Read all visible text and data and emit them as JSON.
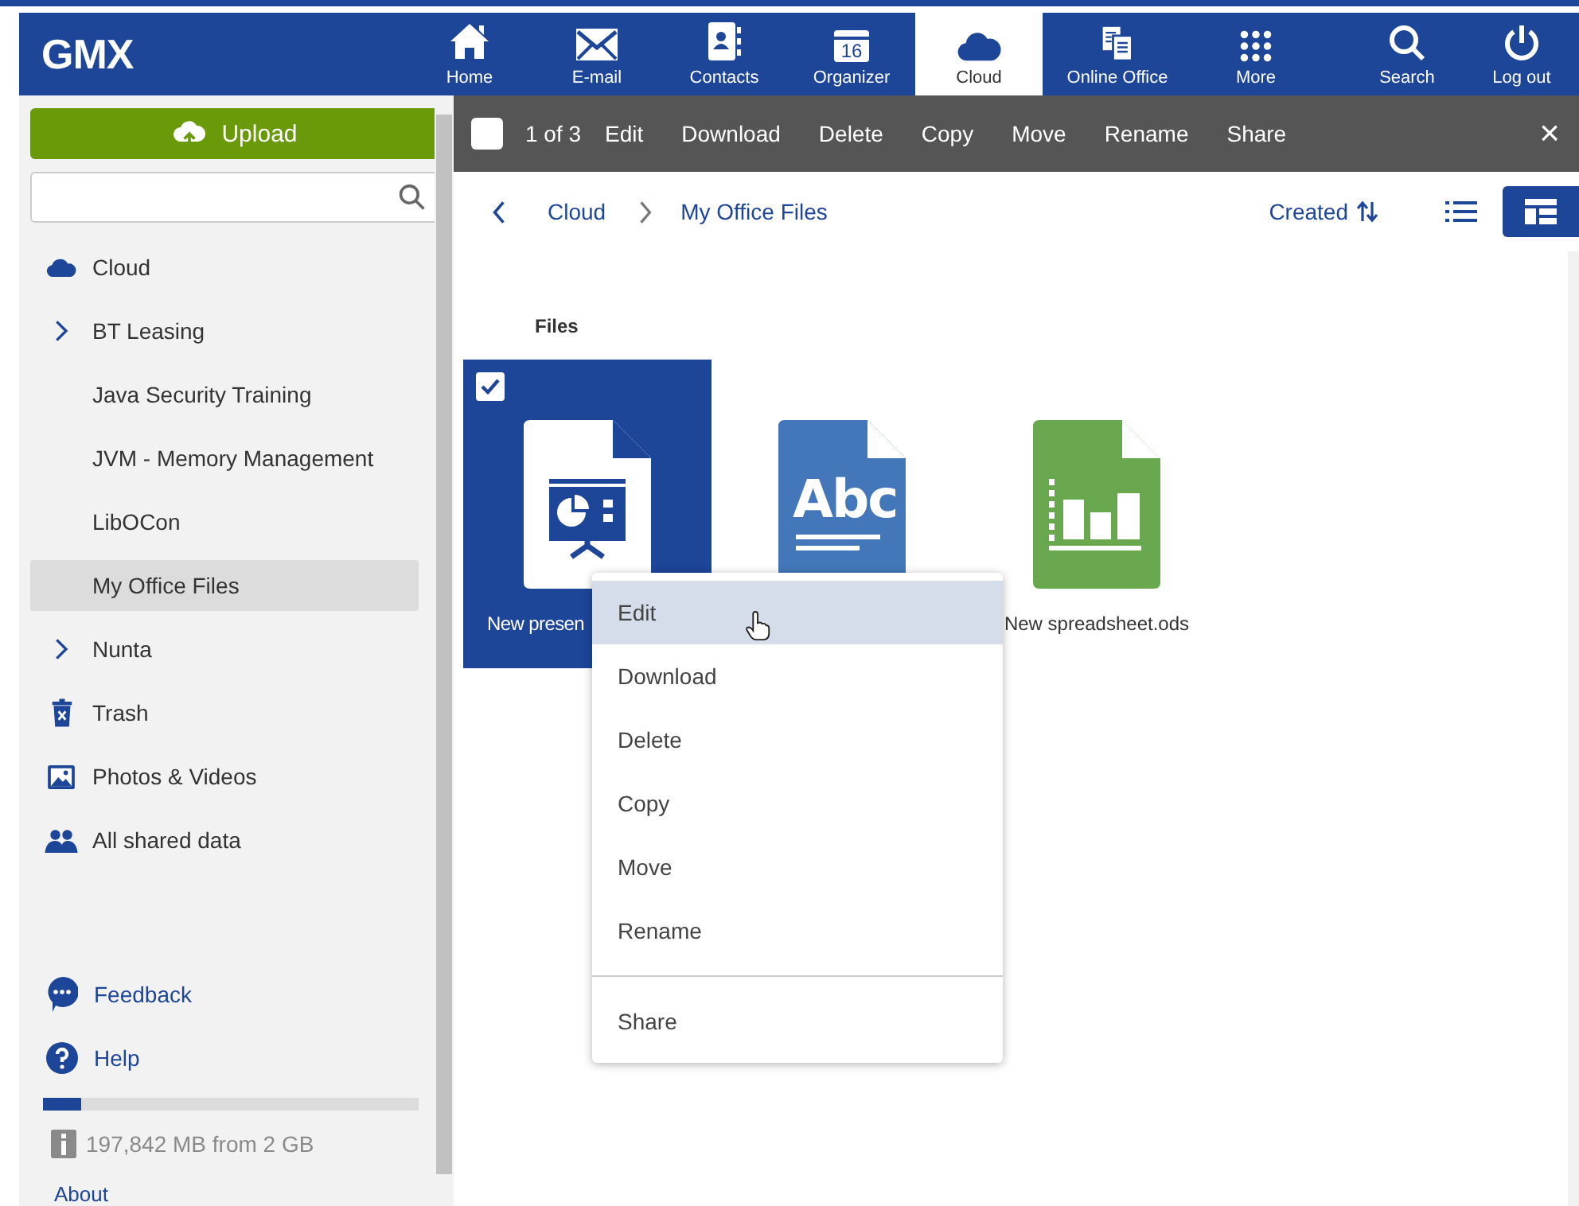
{
  "header": {
    "logo": "GMX",
    "nav": [
      {
        "label": "Home",
        "kind": "home",
        "selected": false
      },
      {
        "label": "E-mail",
        "kind": "mail",
        "selected": false
      },
      {
        "label": "Contacts",
        "kind": "contacts",
        "selected": false
      },
      {
        "label": "Organizer",
        "kind": "calendar",
        "badge": "16",
        "selected": false
      },
      {
        "label": "Cloud",
        "kind": "cloud",
        "selected": true
      },
      {
        "label": "Online Office",
        "kind": "office",
        "selected": false
      },
      {
        "label": "More",
        "kind": "more",
        "selected": false
      }
    ],
    "tools": [
      {
        "label": "Search",
        "kind": "search"
      },
      {
        "label": "Log out",
        "kind": "power"
      }
    ]
  },
  "sidebar": {
    "upload_button": "Upload",
    "items": [
      {
        "label": "Cloud",
        "kind": "cloud",
        "selected": false
      },
      {
        "label": "BT Leasing",
        "kind": "group",
        "expanded": false,
        "selected": false
      },
      {
        "label": "Java Security Training",
        "kind": "folder",
        "selected": false
      },
      {
        "label": "JVM - Memory Management",
        "kind": "folder",
        "selected": false
      },
      {
        "label": "LibOCon",
        "kind": "folder",
        "selected": false
      },
      {
        "label": "My Office Files",
        "kind": "folder",
        "selected": true
      },
      {
        "label": "Nunta",
        "kind": "group",
        "expanded": false,
        "selected": false
      },
      {
        "label": "Trash",
        "kind": "trash",
        "selected": false
      },
      {
        "label": "Photos & Videos",
        "kind": "media",
        "selected": false
      },
      {
        "label": "All shared data",
        "kind": "shared",
        "selected": false
      }
    ],
    "links": [
      {
        "label": "Feedback",
        "kind": "feedback"
      },
      {
        "label": "Help",
        "kind": "help"
      }
    ],
    "storage": {
      "level": 0.1,
      "text": "197,842 MB from 2 GB"
    },
    "about": "About"
  },
  "toolbar": {
    "select_all": {
      "checked": false
    },
    "count": "1 of 3",
    "actions": [
      "Edit",
      "Download",
      "Delete",
      "Copy",
      "Move",
      "Rename",
      "Share"
    ],
    "close": "×"
  },
  "breadcrumb": {
    "items": [
      "Cloud",
      "My Office Files"
    ],
    "sort": "Created",
    "views": [
      {
        "kind": "list",
        "selected": false
      },
      {
        "kind": "grid",
        "selected": true
      }
    ]
  },
  "files": {
    "heading": "Files",
    "items": [
      {
        "name": "New presen",
        "kind": "presentation",
        "selected": true
      },
      {
        "kind": "document",
        "icon_text": "Abc",
        "selected": false
      },
      {
        "name": "New spreadsheet.ods",
        "kind": "spreadsheet",
        "selected": false
      }
    ]
  },
  "context_menu": {
    "items": [
      {
        "label": "Edit",
        "selected": true,
        "separated": false
      },
      {
        "label": "Download",
        "selected": false,
        "separated": false
      },
      {
        "label": "Delete",
        "selected": false,
        "separated": false
      },
      {
        "label": "Copy",
        "selected": false,
        "separated": false
      },
      {
        "label": "Move",
        "selected": false,
        "separated": false
      },
      {
        "label": "Rename",
        "selected": false,
        "separated": false
      },
      {
        "label": "Share",
        "selected": false,
        "separated": true
      }
    ]
  }
}
